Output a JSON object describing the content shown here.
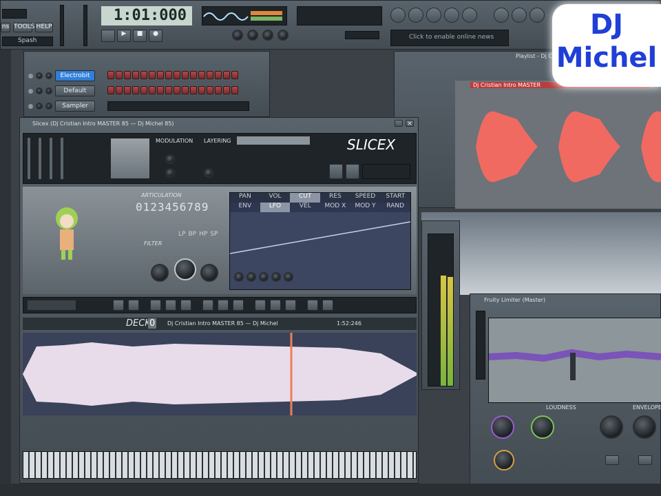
{
  "menu": {
    "items": [
      "ns",
      "TOOLS",
      "HELP"
    ],
    "pattern_label": "Spash"
  },
  "transport": {
    "time": "1:01:000"
  },
  "hint_bar": {
    "text": "Click to enable online news"
  },
  "channel_rack": {
    "channels": [
      {
        "name": "Electrobit",
        "selected": true
      },
      {
        "name": "Default",
        "selected": false
      },
      {
        "name": "Sampler",
        "selected": false
      }
    ]
  },
  "playlist": {
    "title": "Playlist - Dj Cristian",
    "clip_title": "Dj Cristian Intro MASTER"
  },
  "slicex": {
    "window_title": "Slicex (Dj Cristian Intro MASTER 85 — Dj Michel 85)",
    "logo": "SLICEX",
    "modulation_label": "MODULATION",
    "layering_label": "LAYERING",
    "articulation_label": "ARTICULATION",
    "articulation_digits": "0123456789",
    "filter_label": "FILTER",
    "filter_types": [
      "LP",
      "BP",
      "HP",
      "SP"
    ],
    "envelope_tabs": [
      "PAN",
      "VOL",
      "CUT",
      "RES",
      "SPEED",
      "START"
    ],
    "envelope_subtabs": [
      "ENV",
      "LFO",
      "VEL",
      "MOD X",
      "MOD Y",
      "RAND"
    ],
    "deck_label": "DECK",
    "deck_number": "0",
    "deck_sample": "Dj Cristian Intro MASTER 85 — Dj Michel",
    "deck_time": "1:52:246"
  },
  "limiter": {
    "window_title": "Fruity Limiter (Master)",
    "section_left": "LOUDNESS",
    "section_right": "ENVELOPE"
  },
  "watermark": {
    "line1": "DJ",
    "line2": "Michel"
  },
  "colors": {
    "waveform_red": "#f06a62",
    "accent_blue": "#2f7fd8",
    "watermark_blue": "#1f3fd6"
  }
}
